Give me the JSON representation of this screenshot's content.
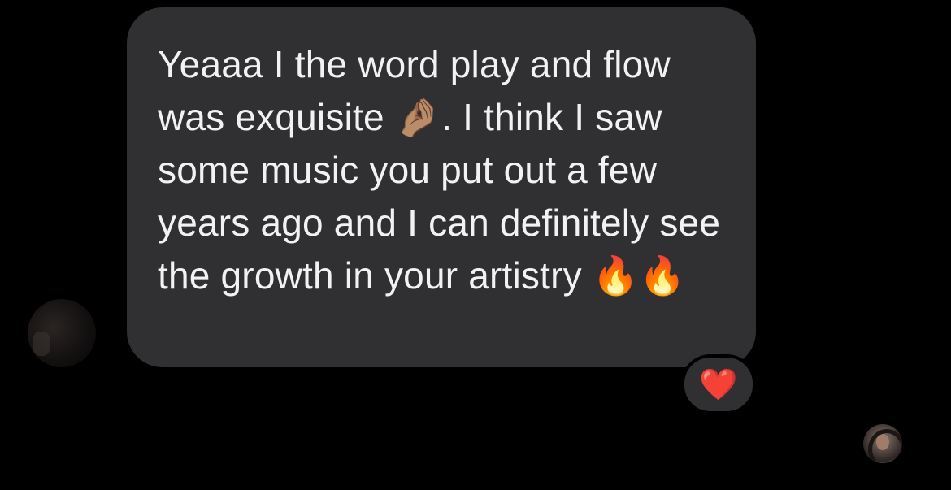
{
  "conversation": {
    "message": {
      "text": "Yeaaa I the word play and flow was exquisite 🤌🏽. I think I saw some music you put out a few years ago and I can definitely see the growth in your artistry 🔥🔥"
    },
    "reaction": {
      "emoji": "❤️",
      "name": "heart-reaction"
    },
    "colors": {
      "background": "#000000",
      "bubble": "#303032",
      "text": "#f2f2f4",
      "heart": "#e0212f"
    }
  }
}
